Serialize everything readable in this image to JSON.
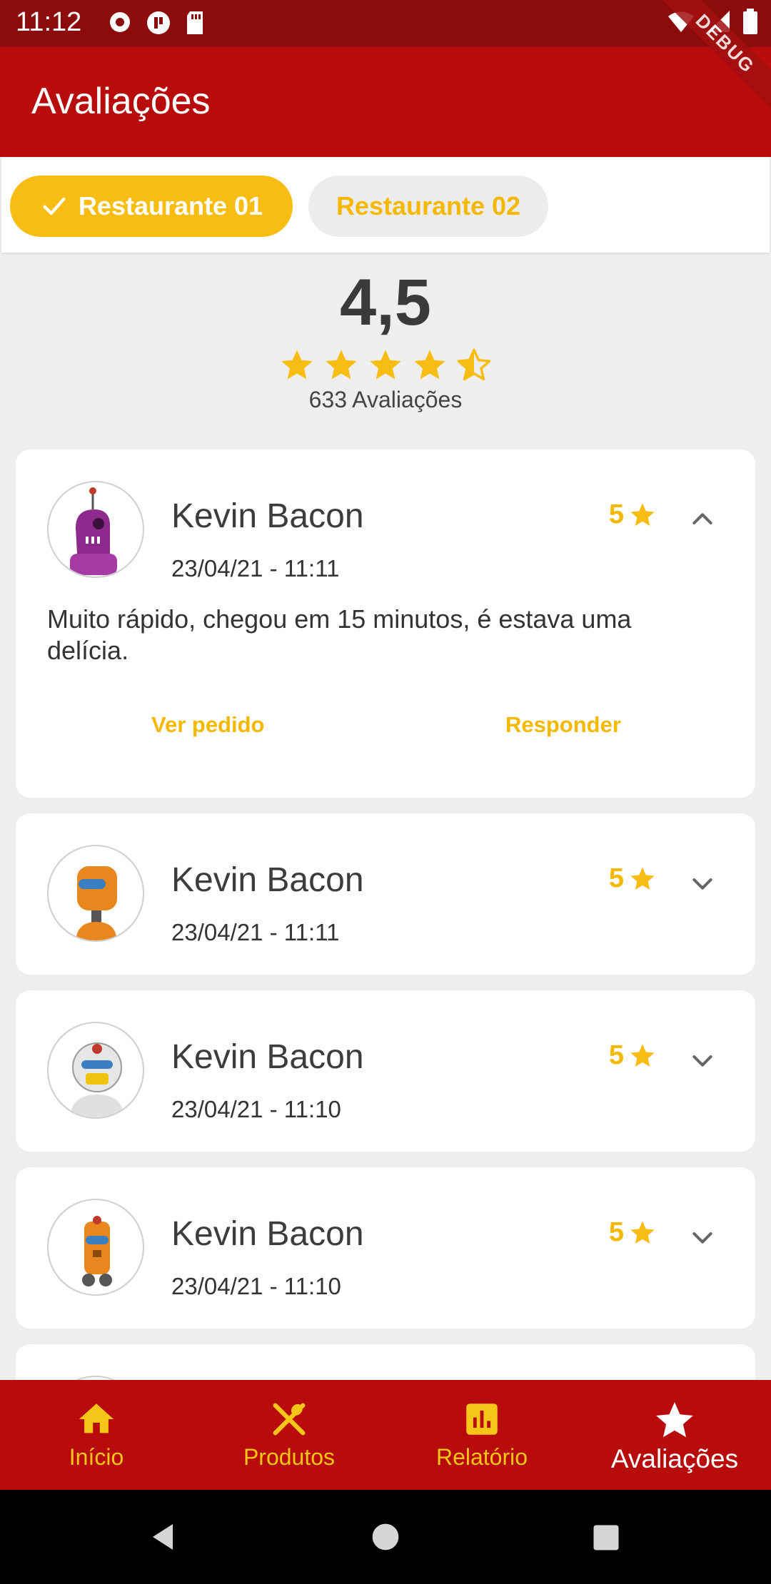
{
  "status_bar": {
    "time": "11:12"
  },
  "app_bar": {
    "title": "Avaliações",
    "debug_label": "DEBUG"
  },
  "filters": [
    {
      "label": "Restaurante 01",
      "selected": true
    },
    {
      "label": "Restaurante 02",
      "selected": false
    }
  ],
  "summary": {
    "average": "4,5",
    "stars": 4.5,
    "count_label": "633 Avaliações"
  },
  "reviews": [
    {
      "name": "Kevin Bacon",
      "date": "23/04/21 - 11:11",
      "rating": "5",
      "expanded": true,
      "comment": "Muito rápido, chegou em 15 minutos, é estava uma delícia.",
      "avatar_color": "#8e2a8e"
    },
    {
      "name": "Kevin Bacon",
      "date": "23/04/21 - 11:11",
      "rating": "5",
      "expanded": false,
      "avatar_color": "#e8871e"
    },
    {
      "name": "Kevin Bacon",
      "date": "23/04/21 - 11:10",
      "rating": "5",
      "expanded": false,
      "avatar_color": "#d9d9d9"
    },
    {
      "name": "Kevin Bacon",
      "date": "23/04/21 - 11:10",
      "rating": "5",
      "expanded": false,
      "avatar_color": "#e8871e"
    }
  ],
  "review_actions": {
    "view_order": "Ver pedido",
    "reply": "Responder"
  },
  "bottom_nav": [
    {
      "label": "Início",
      "icon": "home-icon",
      "active": false
    },
    {
      "label": "Produtos",
      "icon": "utensils-icon",
      "active": false
    },
    {
      "label": "Relatório",
      "icon": "bar-chart-icon",
      "active": false
    },
    {
      "label": "Avaliações",
      "icon": "star-icon",
      "active": true
    }
  ],
  "colors": {
    "primary": "#b80c0c",
    "status_bar": "#8c0b0b",
    "accent": "#f7bd12",
    "background": "#eeeeee"
  }
}
